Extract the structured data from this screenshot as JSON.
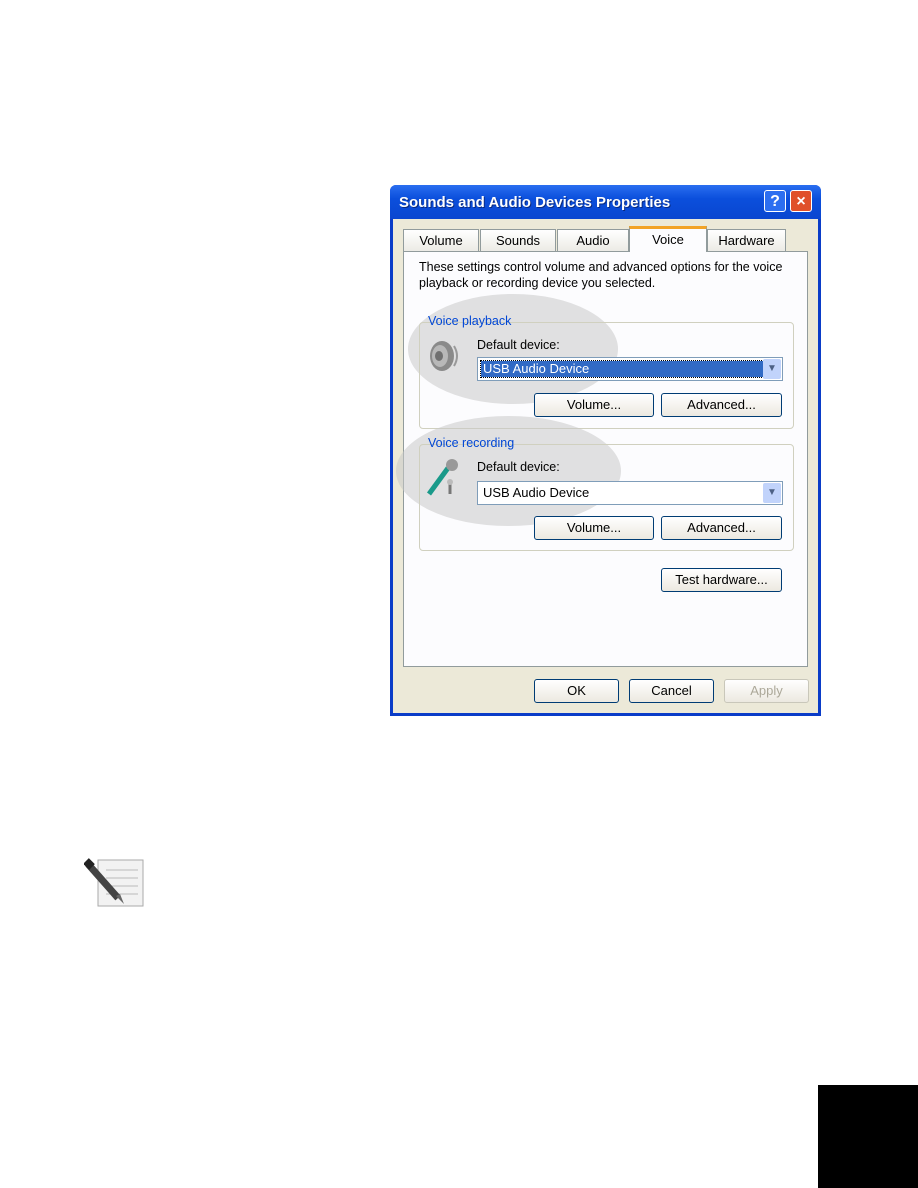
{
  "dialog": {
    "title": "Sounds and Audio Devices Properties",
    "help_icon": "?",
    "close_icon": "×",
    "tabs": [
      {
        "label": "Volume"
      },
      {
        "label": "Sounds"
      },
      {
        "label": "Audio"
      },
      {
        "label": "Voice",
        "selected": true
      },
      {
        "label": "Hardware"
      }
    ],
    "description": "These settings control volume and advanced options for the voice playback or recording device you selected.",
    "playback": {
      "group_label": "Voice playback",
      "device_label": "Default device:",
      "device_value": "USB Audio Device",
      "volume_label": "Volume...",
      "advanced_label": "Advanced...",
      "icon": "speaker-icon"
    },
    "recording": {
      "group_label": "Voice recording",
      "device_label": "Default device:",
      "device_value": "USB Audio Device",
      "volume_label": "Volume...",
      "advanced_label": "Advanced...",
      "icon": "microphone-icon"
    },
    "test_hardware_label": "Test hardware...",
    "ok_label": "OK",
    "cancel_label": "Cancel",
    "apply_label": "Apply"
  },
  "note_icon": "note-pencil-icon"
}
